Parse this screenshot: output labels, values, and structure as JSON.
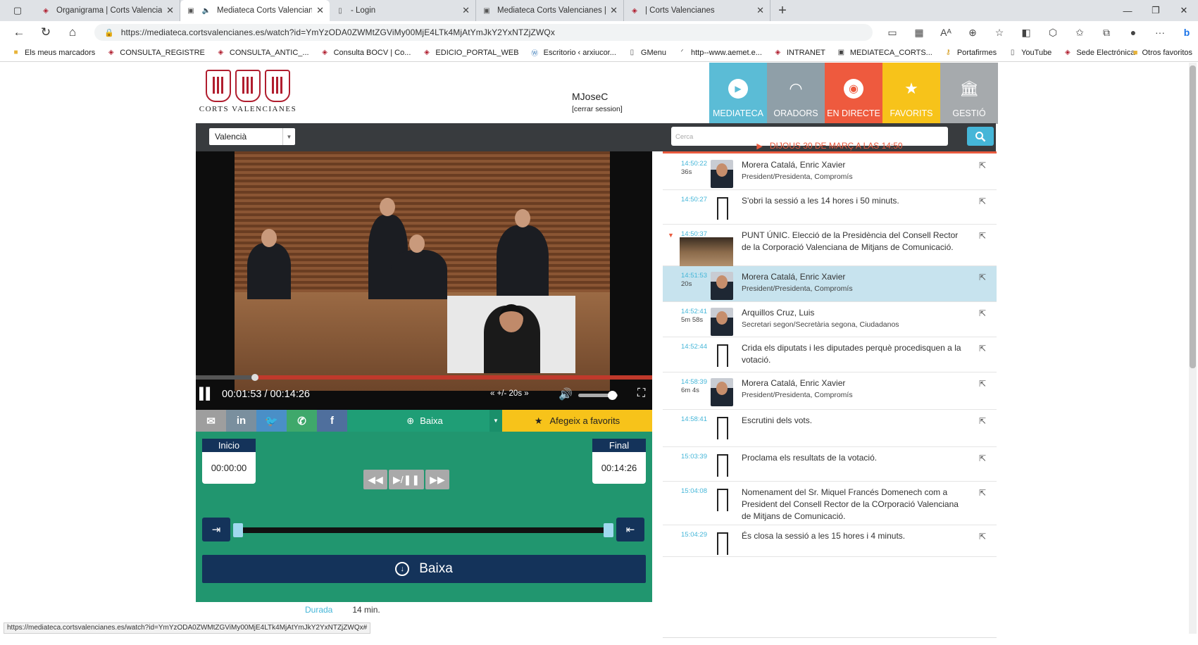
{
  "browser": {
    "tabs": [
      {
        "title": "Organigrama | Corts Valencianes",
        "favicon": "corts-icon"
      },
      {
        "title": "Mediateca Corts Valencianes",
        "favicon": "mediateca-icon",
        "active": true
      },
      {
        "title": "- Login",
        "favicon": "page-icon"
      },
      {
        "title": "Mediateca Corts Valencianes | Or",
        "favicon": "mediateca-icon"
      },
      {
        "title": "| Corts Valencianes",
        "favicon": "corts-icon"
      }
    ],
    "url": "https://mediateca.cortsvalencianes.es/watch?id=YmYzODA0ZWMtZGViMy00MjE4LTk4MjAtYmJkY2YxNTZjZWQx",
    "bookmarks": [
      "Els meus marcadors",
      "CONSULTA_REGISTRE",
      "CONSULTA_ANTIC_...",
      "Consulta BOCV | Co...",
      "EDICIO_PORTAL_WEB",
      "Escritorio ‹ arxiucor...",
      "GMenu",
      "http--www.aemet.e...",
      "INTRANET",
      "MEDIATECA_CORTS...",
      "Portafirmes",
      "YouTube",
      "Sede Electrónica"
    ],
    "other_favorites": "Otros favoritos",
    "status_url": "https://mediateca.cortsvalencianes.es/watch?id=YmYzODA0ZWMtZGViMy00MjE4LTk4MjAtYmJkY2YxNTZjZWQx#"
  },
  "site": {
    "logo_text": "CORTS VALENCIANES",
    "username": "MJoseC",
    "logout": "[cerrar session]",
    "nav": [
      {
        "label": "MEDIATECA",
        "color": "#5bbcd6",
        "icon": "play-circle-icon"
      },
      {
        "label": "ORADORS",
        "color": "#8f9fa8",
        "icon": "person-icon"
      },
      {
        "label": "EN DIRECTE",
        "color": "#ee5a3e",
        "icon": "live-icon"
      },
      {
        "label": "FAVORITS",
        "color": "#f7c31a",
        "icon": "star-icon"
      },
      {
        "label": "GESTIÓ",
        "color": "#a6aaad",
        "icon": "institution-icon"
      }
    ],
    "language": "Valencià",
    "search_placeholder": "Cerca"
  },
  "player": {
    "time": "00:01:53 / 00:14:26",
    "progress": 0.13,
    "skip": "« +/- 20s »",
    "volume": 0.85
  },
  "share": {
    "baixa": "Baixa",
    "favorites": "Afegeix a favorits",
    "colors": {
      "email": "#9e9e9e",
      "linkedin": "#7a8f9e",
      "twitter": "#4a8fc7",
      "whatsapp": "#3fa86b",
      "facebook": "#4f6f9d"
    }
  },
  "clip": {
    "start_label": "Inicio",
    "start_value": "00:00:00",
    "end_label": "Final",
    "end_value": "00:14:26",
    "download": "Baixa"
  },
  "durada": {
    "label": "Durada",
    "value": "14 min."
  },
  "session_header": "DIJOUS 30 DE MARÇ A LAS 14:50",
  "interventions": [
    {
      "time": "14:50:22",
      "dur": "36s",
      "type": "speaker",
      "title": "Morera Catalá, Enric Xavier",
      "subtitle": "President/Presidenta, Compromís",
      "h": 51
    },
    {
      "time": "14:50:27",
      "dur": "",
      "type": "bookmark",
      "title": "S'obri la sessió a les 14 hores i 50 minuts.",
      "subtitle": "",
      "h": 49
    },
    {
      "time": "14:50:37",
      "dur": "",
      "type": "point",
      "title": "PUNT ÚNIC. Elecció de la Presidència del Consell Rector de la Corporació Valenciana de Mitjans de Comunicació.",
      "subtitle": "",
      "h": 59
    },
    {
      "time": "14:51:53",
      "dur": "20s",
      "type": "speaker",
      "title": "Morera Catalá, Enric Xavier",
      "subtitle": "President/Presidenta, Compromís",
      "h": 51,
      "highlight": true
    },
    {
      "time": "14:52:41",
      "dur": "5m 58s",
      "type": "speaker",
      "title": "Arquillos Cruz, Luis",
      "subtitle": "Secretari segon/Secretària segona, Ciudadanos",
      "h": 50
    },
    {
      "time": "14:52:44",
      "dur": "",
      "type": "bookmark",
      "title": "Crida els diputats i les diputades perquè procedisquen a la votació.",
      "subtitle": "",
      "h": 50
    },
    {
      "time": "14:58:39",
      "dur": "6m 4s",
      "type": "speaker",
      "title": "Morera Catalá, Enric Xavier",
      "subtitle": "President/Presidenta, Compromís",
      "h": 53
    },
    {
      "time": "14:58:41",
      "dur": "",
      "type": "bookmark",
      "title": "Escrutini dels vots.",
      "subtitle": "",
      "h": 53
    },
    {
      "time": "15:03:39",
      "dur": "",
      "type": "bookmark",
      "title": "Proclama els resultats de la votació.",
      "subtitle": "",
      "h": 49
    },
    {
      "time": "15:04:08",
      "dur": "",
      "type": "bookmark",
      "title": "Nomenament del Sr. Miquel Francés Domenech com a President del Consell Rector de la COrporació Valenciana de Mitjans de Comunicació.",
      "subtitle": "",
      "h": 62
    },
    {
      "time": "15:04:29",
      "dur": "",
      "type": "bookmark",
      "title": "És closa la sessió a les 15 hores i 4 minuts.",
      "subtitle": "",
      "h": 45
    }
  ]
}
